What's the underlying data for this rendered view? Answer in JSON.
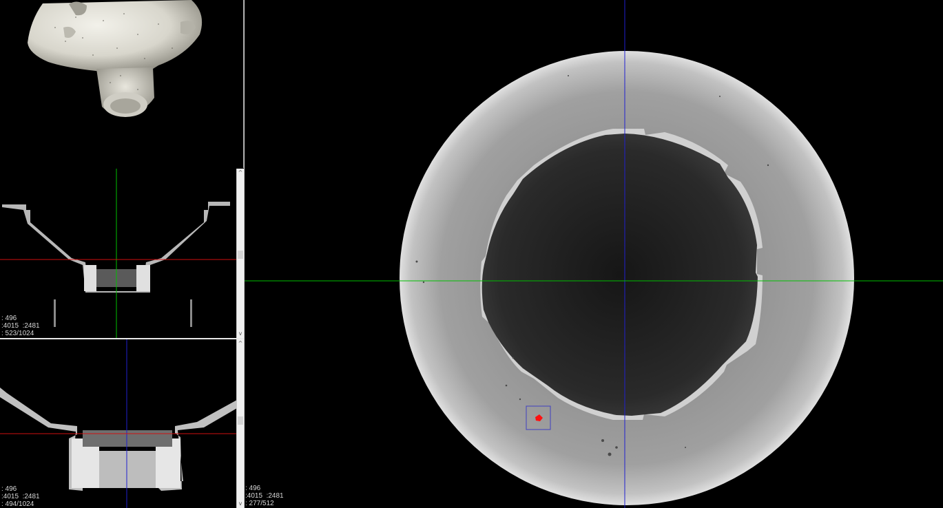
{
  "views": {
    "render3d": {},
    "sagittal": {
      "overlay": {
        "line1": ": 496",
        "line2": ":4015  :2481",
        "line3": ": 523/1024"
      },
      "scroll_up": "^",
      "scroll_down": "v",
      "slice_fraction": 0.51
    },
    "coronal": {
      "overlay": {
        "line1": ": 496",
        "line2": ":4015  :2481",
        "line3": ": 494/1024"
      },
      "scroll_up": "^",
      "scroll_down": "v",
      "slice_fraction": 0.48
    },
    "axial": {
      "overlay": {
        "line1": ": 496",
        "line2": ":4015  :2481",
        "line3": ": 277/512"
      }
    }
  },
  "colors": {
    "crosshair_green": "#00c000",
    "crosshair_blue": "#2020d0",
    "crosshair_red": "#d01010",
    "roi_box": "#4040c0",
    "marker_red": "#ff1010"
  },
  "icons": {
    "scroll_up": "chevron-up-icon",
    "scroll_down": "chevron-down-icon"
  }
}
